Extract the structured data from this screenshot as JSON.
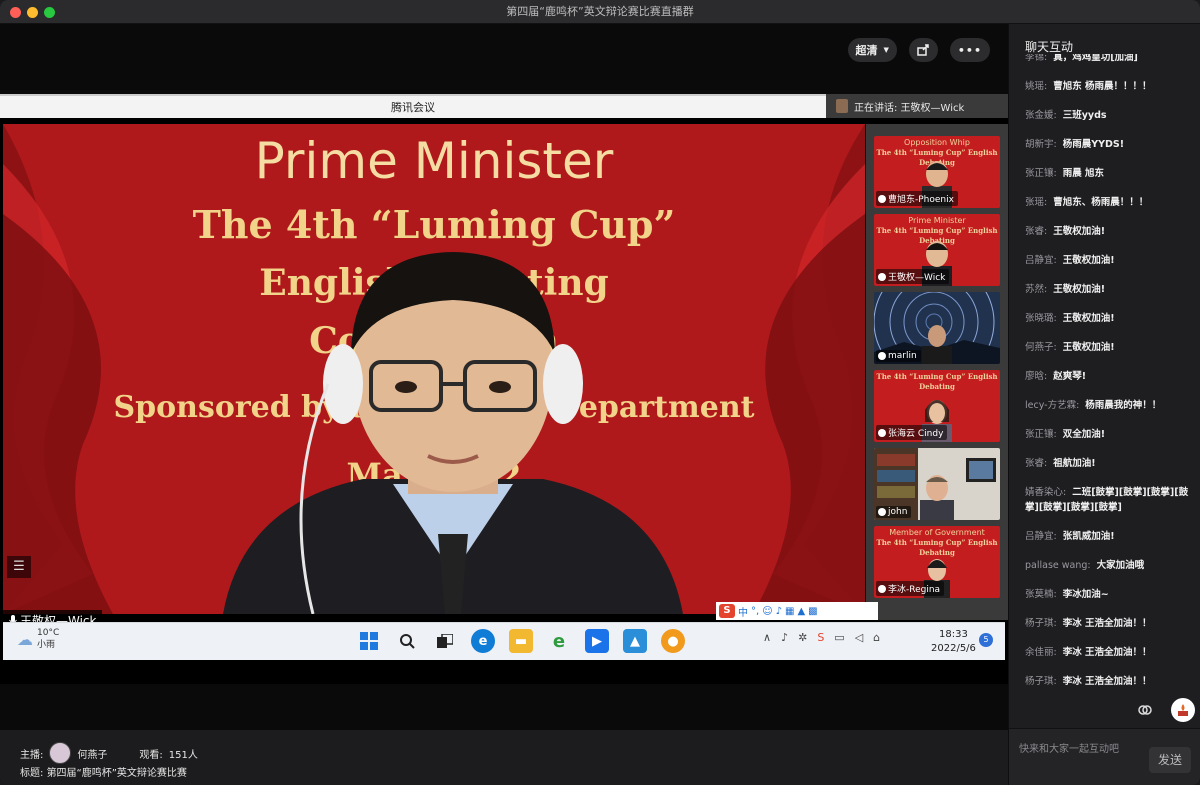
{
  "window": {
    "title": "第四届“鹿鸣杯”英文辩论赛比赛直播群"
  },
  "player": {
    "quality_label": "超清",
    "meeting_bar_title": "腾讯会议",
    "speaking_label": "正在讲话: 王敬权—Wick",
    "main_speaker_name": "王敬权—Wick"
  },
  "slide": {
    "line1": "Prime Minister",
    "line2": "The 4th “Luming Cup”",
    "line3": "English Debating",
    "line4": "Competition",
    "line5": "Sponsored by the English Department",
    "line6": "May 2022"
  },
  "participants": [
    {
      "name": "曹旭东-Phoenix",
      "slide_top": "Opposition Whip",
      "slide_sub": "The 4th “Luming Cup” English Debating",
      "bg": "red"
    },
    {
      "name": "王敬权—Wick",
      "slide_top": "Prime Minister",
      "slide_sub": "The 4th “Luming Cup” English Debating",
      "bg": "red"
    },
    {
      "name": "marlin",
      "slide_top": "",
      "slide_sub": "",
      "bg": "star"
    },
    {
      "name": "张海云 Cindy",
      "slide_top": "",
      "slide_sub": "The 4th “Luming Cup” English Debating",
      "bg": "red"
    },
    {
      "name": "john",
      "slide_top": "",
      "slide_sub": "",
      "bg": "room"
    },
    {
      "name": "李冰-Regina",
      "slide_top": "Member of Government",
      "slide_sub": "The 4th “Luming Cup” English Debating",
      "bg": "red"
    }
  ],
  "ime": {
    "mode": "中"
  },
  "taskbar": {
    "temperature": "10°C",
    "weather": "小雨",
    "time": "18:33",
    "date": "2022/5/6",
    "notifications": "5"
  },
  "footer": {
    "host_label": "主播:",
    "host_name": "何燕子",
    "viewers_label": "观看:",
    "viewers_count": "151人",
    "title_label": "标题:",
    "title_value": "第四届“鹿鸣杯”英文辩论赛比赛"
  },
  "chat": {
    "header": "聊天互动",
    "messages": [
      {
        "user": "李锦:",
        "text": "真，鸡鸡皇功[加油]"
      },
      {
        "user": "姚瑶:",
        "text": "曹旭东 杨雨晨！！！！"
      },
      {
        "user": "张金媛:",
        "text": "三班yyds"
      },
      {
        "user": "胡新宇:",
        "text": "杨雨晨YYDS!"
      },
      {
        "user": "张正镶:",
        "text": "雨晨 旭东"
      },
      {
        "user": "张瑶:",
        "text": "曹旭东、杨雨晨！！！"
      },
      {
        "user": "张睿:",
        "text": "王敬权加油!"
      },
      {
        "user": "吕静宜:",
        "text": "王敬权加油!"
      },
      {
        "user": "苏然:",
        "text": "王敬权加油!"
      },
      {
        "user": "张晓璐:",
        "text": "王敬权加油!"
      },
      {
        "user": "何燕子:",
        "text": "王敬权加油!"
      },
      {
        "user": "廖晗:",
        "text": "赵爽琴!"
      },
      {
        "user": "lecy-方艺霖:",
        "text": "杨雨晨我的神！！"
      },
      {
        "user": "张正镶:",
        "text": "双全加油!"
      },
      {
        "user": "张睿:",
        "text": "祖航加油!"
      },
      {
        "user": "婧香染心:",
        "text": "二班[鼓掌][鼓掌][鼓掌][鼓掌][鼓掌][鼓掌][鼓掌]"
      },
      {
        "user": "吕静宜:",
        "text": "张凯威加油!"
      },
      {
        "user": "pallase wang:",
        "text": "大家加油哦"
      },
      {
        "user": "张莫楠:",
        "text": "李冰加油~"
      },
      {
        "user": "杨子琪:",
        "text": "李冰 王浩全加油！！"
      },
      {
        "user": "余佳丽:",
        "text": "李冰 王浩全加油！！"
      },
      {
        "user": "杨子琪:",
        "text": "李冰 王浩全加油！！"
      }
    ],
    "input_placeholder": "快来和大家一起互动吧",
    "send_label": "发送"
  },
  "colors": {
    "slide_red": "#b0191b",
    "slide_gold": "#f2d38a",
    "accent_blue": "#2e6fd8"
  }
}
